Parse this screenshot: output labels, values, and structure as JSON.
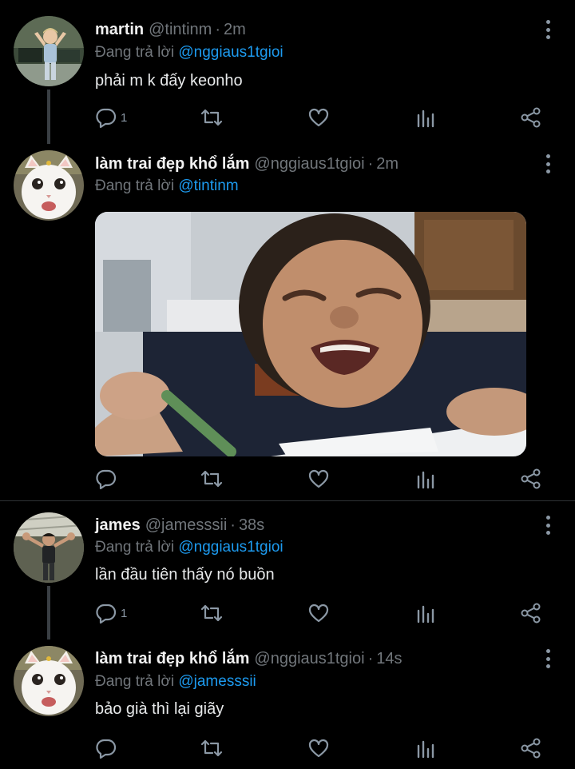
{
  "tweets": [
    {
      "name": "martin",
      "handle": "@tintinm",
      "time": "2m",
      "reply_prefix": "Đang trả lời",
      "reply_to": "@nggiaus1tgioi",
      "text": "phải m k đấy keonho",
      "reply_count": "1"
    },
    {
      "name": "làm trai đẹp khổ lắm",
      "handle": "@nggiaus1tgioi",
      "time": "2m",
      "reply_prefix": "Đang trả lời",
      "reply_to": "@tintinm",
      "text": "",
      "reply_count": ""
    },
    {
      "name": "james",
      "handle": "@jamesssii",
      "time": "38s",
      "reply_prefix": "Đang trả lời",
      "reply_to": "@nggiaus1tgioi",
      "text": "lần đầu tiên thấy nó buồn",
      "reply_count": "1"
    },
    {
      "name": "làm trai đẹp khổ lắm",
      "handle": "@nggiaus1tgioi",
      "time": "14s",
      "reply_prefix": "Đang trả lời",
      "reply_to": "@jamesssii",
      "text": "bảo già thì lại giãy",
      "reply_count": ""
    }
  ],
  "icons": {
    "reply": "reply-icon",
    "retweet": "retweet-icon",
    "like": "heart-icon",
    "analytics": "analytics-icon",
    "share": "share-icon",
    "more": "more-vertical-icon"
  },
  "colors": {
    "background": "#000000",
    "mention": "#1d9bf0",
    "muted": "#71767b",
    "icon": "#8b98a5"
  }
}
